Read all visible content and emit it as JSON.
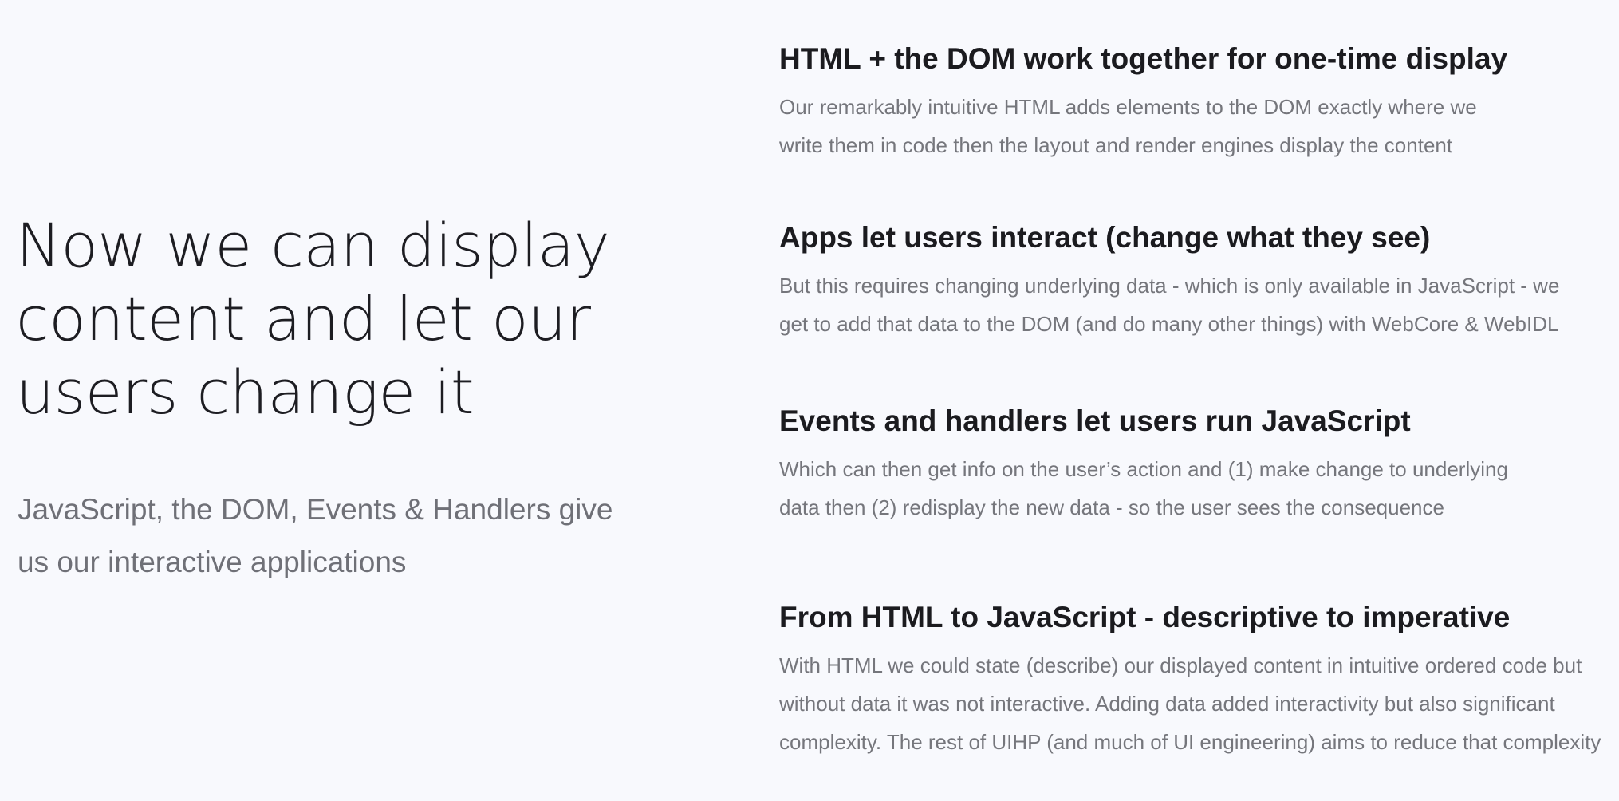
{
  "hero": {
    "title": "Now we can display\ncontent and let our\nusers change it",
    "subtitle": "JavaScript, the DOM, Events & Handlers give\nus our interactive applications"
  },
  "points": [
    {
      "heading": "HTML + the DOM work together for one-time display",
      "body": "Our remarkably intuitive HTML adds elements to the DOM exactly where we\nwrite them in code then the layout and render engines display the content"
    },
    {
      "heading": "Apps let users interact (change what they see)",
      "body": "But this requires changing underlying data - which is only available in JavaScript - we\nget to add that data to the DOM (and do many other things) with WebCore & WebIDL"
    },
    {
      "heading": "Events and handlers let users run JavaScript",
      "body": "Which can then get info on the user’s action and (1) make change to underlying\ndata then (2) redisplay the new data - so the user sees the consequence"
    },
    {
      "heading": "From HTML to JavaScript - descriptive to imperative",
      "body": "With HTML we could state (describe) our displayed content in intuitive ordered code but\nwithout data it was not interactive. Adding data added interactivity but also significant\ncomplexity. The rest of UIHP (and much of UI engineering) aims to reduce that complexity"
    }
  ]
}
